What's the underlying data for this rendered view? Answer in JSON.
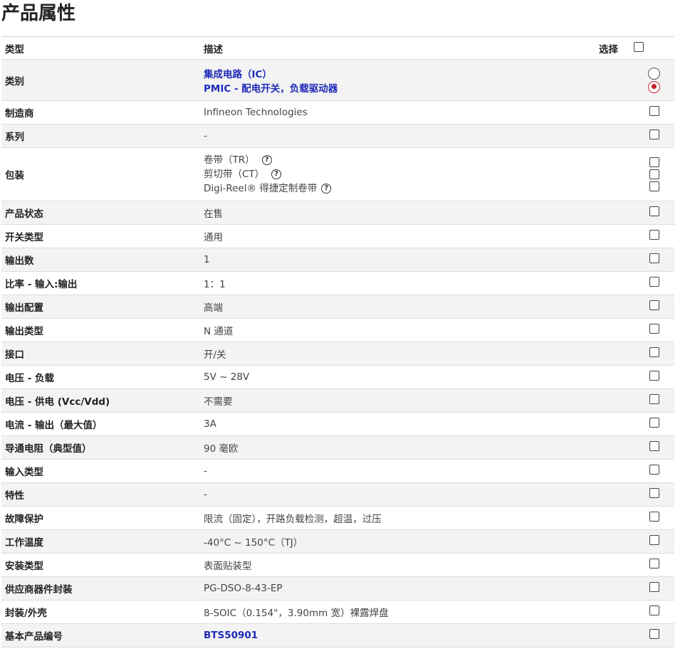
{
  "title": "产品属性",
  "header": {
    "type": "类型",
    "desc": "描述",
    "select": "选择"
  },
  "rows": [
    {
      "label": "类别",
      "values": [
        "集成电路（IC）",
        "PMIC - 配电开关，负载驱动器"
      ]
    },
    {
      "label": "制造商",
      "value": "Infineon Technologies"
    },
    {
      "label": "系列",
      "value": "-"
    },
    {
      "label": "包装",
      "values": [
        "卷带（TR）",
        "剪切带（CT）",
        "Digi-Reel® 得捷定制卷带"
      ]
    },
    {
      "label": "产品状态",
      "value": "在售"
    },
    {
      "label": "开关类型",
      "value": "通用"
    },
    {
      "label": "输出数",
      "value": "1"
    },
    {
      "label": "比率 - 输入:输出",
      "value": "1：1"
    },
    {
      "label": "输出配置",
      "value": "高端"
    },
    {
      "label": "输出类型",
      "value": "N 通道"
    },
    {
      "label": "接口",
      "value": "开/关"
    },
    {
      "label": "电压 - 负载",
      "value": "5V ~ 28V"
    },
    {
      "label": "电压 - 供电 (Vcc/Vdd)",
      "value": "不需要"
    },
    {
      "label": "电流 - 输出（最大值）",
      "value": "3A"
    },
    {
      "label": "导通电阻（典型值）",
      "value": "90 毫欧"
    },
    {
      "label": "输入类型",
      "value": "-"
    },
    {
      "label": "特性",
      "value": "-"
    },
    {
      "label": "故障保护",
      "value": "限流（固定），开路负载检测，超温，过压"
    },
    {
      "label": "工作温度",
      "value": "-40°C ~ 150°C（TJ）"
    },
    {
      "label": "安装类型",
      "value": "表面贴装型"
    },
    {
      "label": "供应商器件封装",
      "value": "PG-DSO-8-43-EP"
    },
    {
      "label": "封装/外壳",
      "value": "8-SOIC（0.154\"，3.90mm 宽）裸露焊盘"
    },
    {
      "label": "基本产品编号",
      "value": "BTS50901"
    }
  ],
  "help_glyph": "?",
  "colors": {
    "link": "#1f2bb8",
    "radio_selected": "#c81f2b"
  }
}
